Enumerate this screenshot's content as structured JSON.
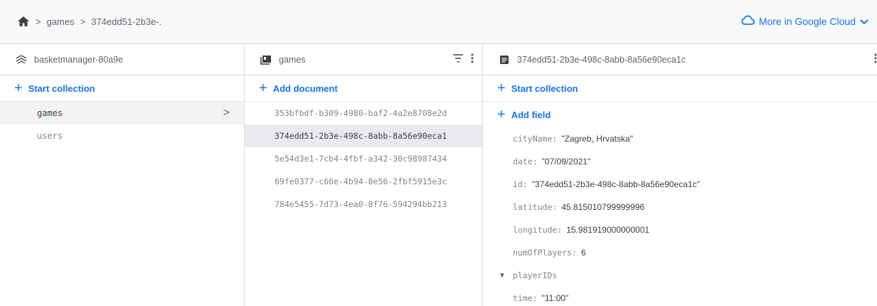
{
  "breadcrumb": {
    "home_icon": "home-icon",
    "items": [
      "games",
      "374edd51-2b3e-."
    ]
  },
  "top_actions": {
    "more_label": "More in Google Cloud"
  },
  "panel1": {
    "title": "basketmanager-80a9e",
    "action": "Start collection",
    "items": [
      {
        "label": "games",
        "selected": true
      },
      {
        "label": "users",
        "selected": false
      }
    ]
  },
  "panel2": {
    "title": "games",
    "action": "Add document",
    "documents": [
      "353bfbdf-b309-4980-baf2-4a2e8708e2d",
      "374edd51-2b3e-498c-8abb-8a56e90eca1",
      "5e54d3e1-7cb4-4fbf-a342-30c98987434",
      "69fe0377-c66e-4b94-8e56-2fbf5915e3c",
      "784e5455-7d73-4ea0-8f76-594294bb213"
    ]
  },
  "panel3": {
    "title": "374edd51-2b3e-498c-8abb-8a56e90eca1c",
    "action": "Start collection",
    "add_field": "Add field",
    "fields": [
      {
        "key": "cityName",
        "value": "\"Zagreb, Hrvatska\""
      },
      {
        "key": "date",
        "value": "\"07/09/2021\""
      },
      {
        "key": "id",
        "value": "\"374edd51-2b3e-498c-8abb-8a56e90eca1c\""
      },
      {
        "key": "latitude",
        "value": "45.815010799999996"
      },
      {
        "key": "longitude",
        "value": "15.981919000000001"
      },
      {
        "key": "numOfPlayers",
        "value": "6"
      },
      {
        "key": "playerIDs",
        "value": ""
      },
      {
        "key": "time",
        "value": "\"11:00\""
      }
    ]
  },
  "colors": {
    "accent": "#1a73e8",
    "muted": "#80868b",
    "border": "#dadce0"
  }
}
